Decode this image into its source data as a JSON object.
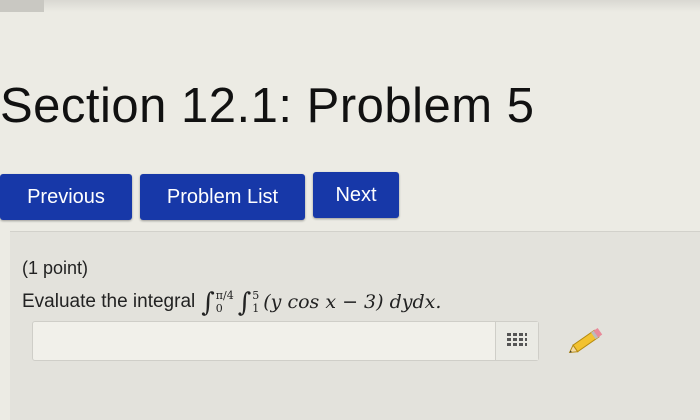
{
  "page": {
    "title": "Section 12.1: Problem 5"
  },
  "nav": {
    "previous_label": "Previous",
    "problem_list_label": "Problem List",
    "next_label": "Next"
  },
  "problem": {
    "points": "(1 point)",
    "prompt": "Evaluate the integral",
    "outer_upper": "π/4",
    "outer_lower": "0",
    "inner_upper": "5",
    "inner_lower": "1",
    "integrand": "(y cos x − 3) dydx.",
    "answer_value": "",
    "answer_placeholder": ""
  },
  "icons": {
    "equation_editor": "grid-icon",
    "edit": "pencil-icon"
  },
  "colors": {
    "button_blue": "#1738a8",
    "background": "#ecebe4"
  }
}
